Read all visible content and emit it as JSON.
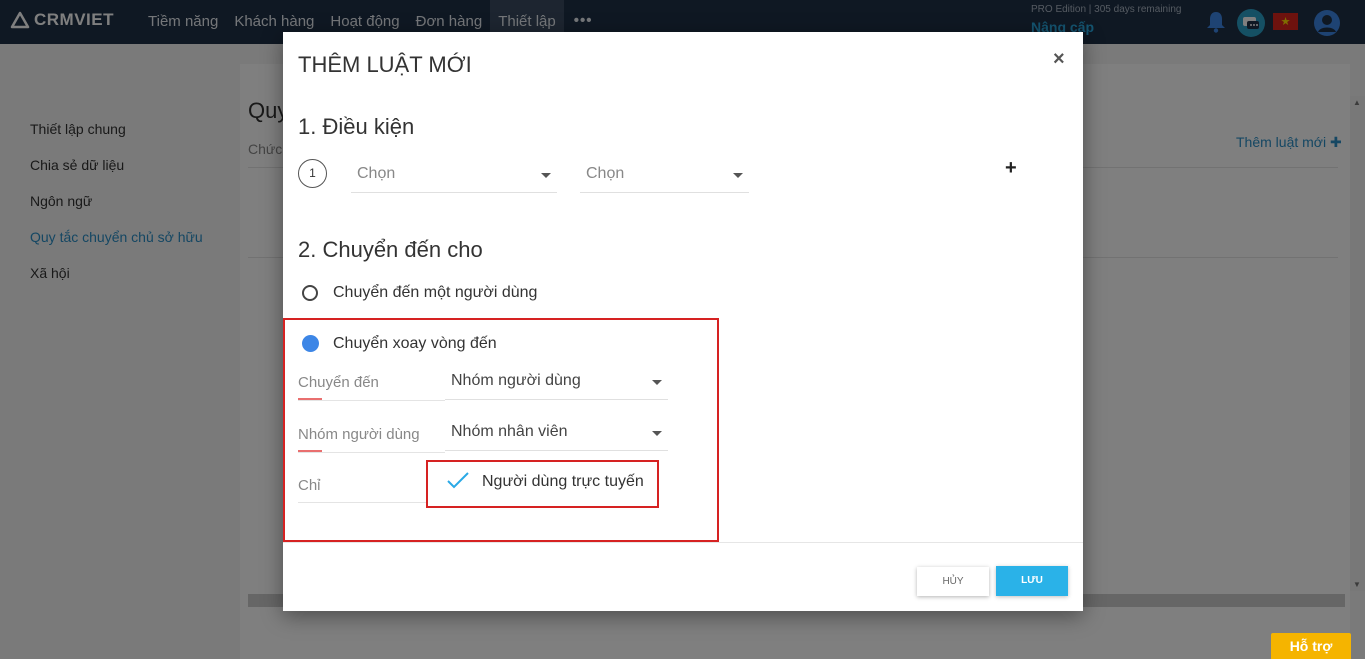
{
  "app": {
    "name": "CRMVIET"
  },
  "nav": {
    "items": [
      "Tiềm năng",
      "Khách hàng",
      "Hoạt động",
      "Đơn hàng",
      "Thiết lập"
    ],
    "active_index": 4,
    "more": "•••"
  },
  "header": {
    "edition": "PRO Edition | 305 days remaining",
    "upgrade": "Nâng cấp",
    "icons": [
      "bell-icon",
      "chat-icon",
      "vietnam-flag-icon",
      "user-icon"
    ]
  },
  "sidebar": {
    "items": [
      {
        "label": "Thiết lập chung"
      },
      {
        "label": "Chia sẻ dữ liệu"
      },
      {
        "label": "Ngôn ngữ"
      },
      {
        "label": "Quy tắc chuyển chủ sở hữu",
        "active": true
      },
      {
        "label": "Xã hội"
      }
    ]
  },
  "content": {
    "title": "Quy",
    "subtitle": "Chức",
    "add_rule": "Thêm luật mới"
  },
  "modal": {
    "title": "THÊM LUẬT MỚI",
    "close": "×",
    "section1": "1. Điều kiện",
    "condition_number": "1",
    "select1": "Chọn",
    "select2": "Chọn",
    "add": "+",
    "section2": "2. Chuyển đến cho",
    "radio1": "Chuyển đến một người dùng",
    "radio2": "Chuyển xoay vòng đến",
    "selected_radio": "radio2",
    "fields": [
      {
        "label": "Chuyển đến",
        "value": "Nhóm người dùng"
      },
      {
        "label": "Nhóm người dùng",
        "value": "Nhóm nhân viên"
      },
      {
        "label": "Chỉ"
      }
    ],
    "checkbox_label": "Người dùng trực tuyến",
    "checkbox_checked": true,
    "cancel": "HỦY",
    "save": "LƯU"
  },
  "support": "Hỗ trợ",
  "colors": {
    "topbar": "#1f3147",
    "accent": "#2ab2e8",
    "highlight": "#d62222",
    "support": "#f5b400"
  }
}
